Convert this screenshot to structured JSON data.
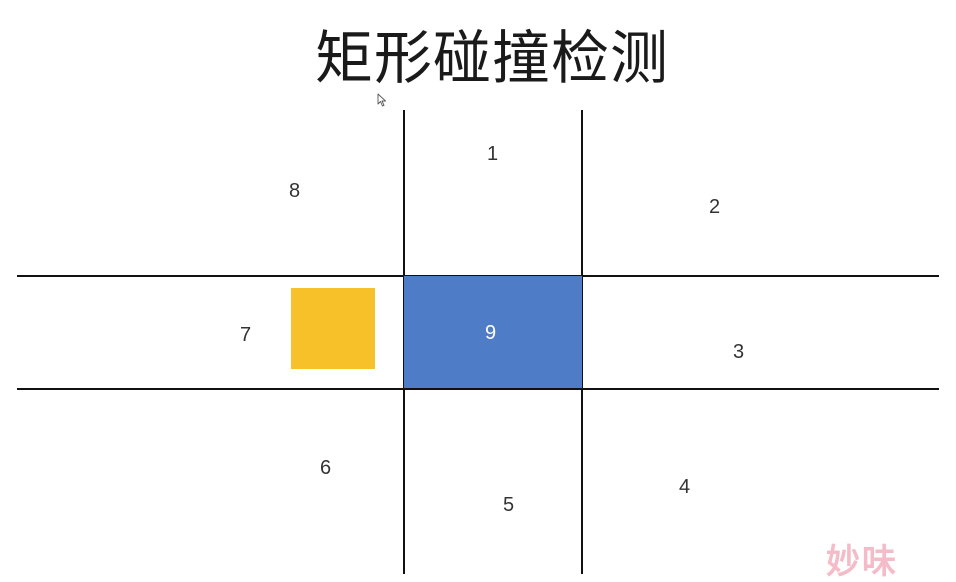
{
  "title": "矩形碰撞检测",
  "regions": {
    "r1": "1",
    "r2": "2",
    "r3": "3",
    "r4": "4",
    "r5": "5",
    "r6": "6",
    "r7": "7",
    "r8": "8",
    "r9": "9"
  },
  "colors": {
    "center_rect": "#4f7cc7",
    "moving_rect": "#f7c12a",
    "grid_lines": "#111111"
  },
  "icons": {
    "cursor": "mouse-pointer-icon"
  },
  "watermark": "妙味"
}
